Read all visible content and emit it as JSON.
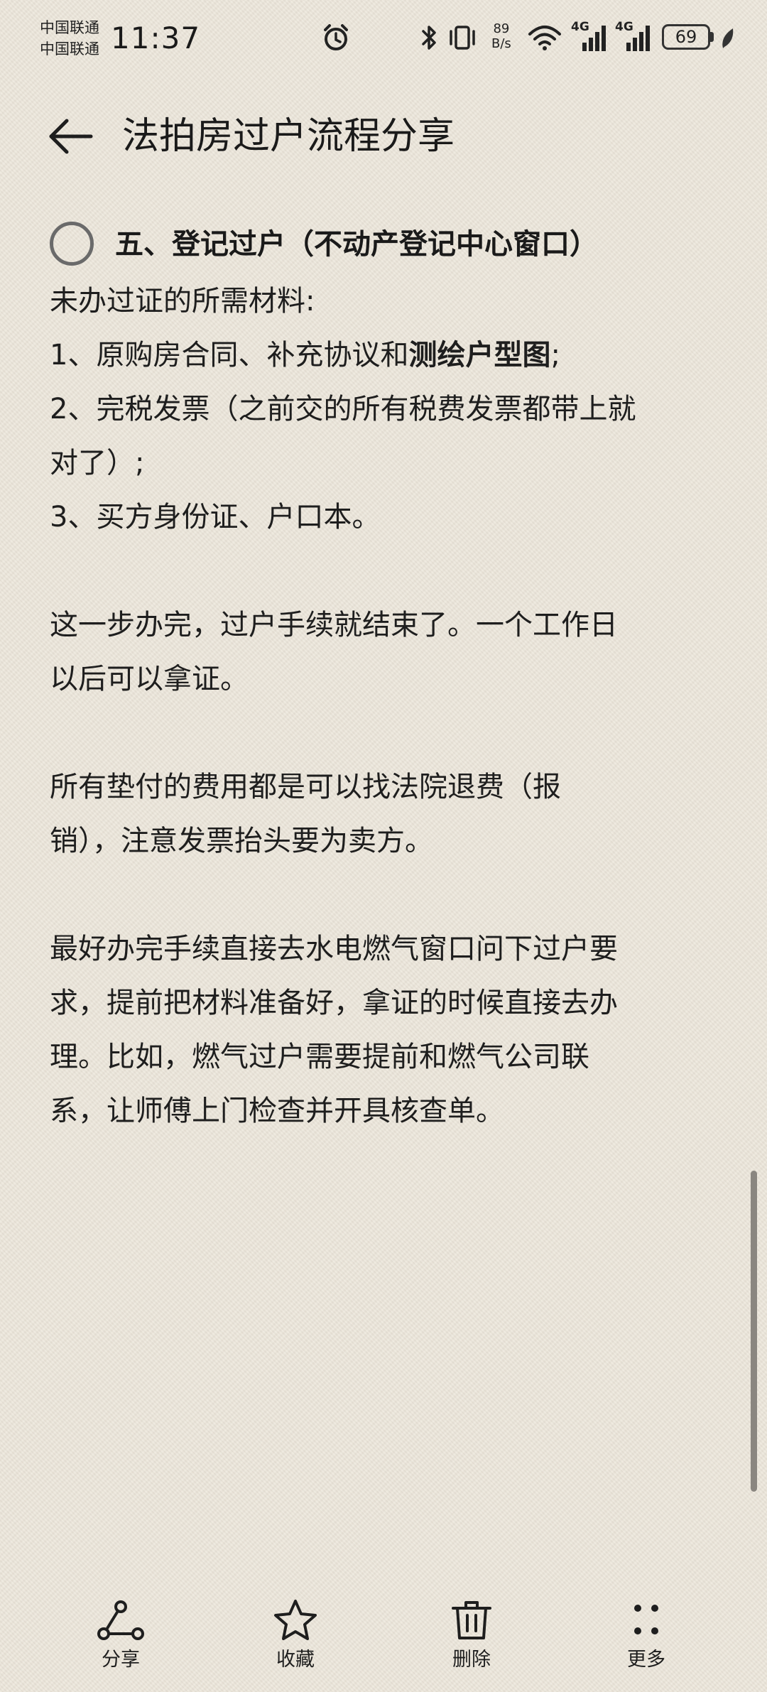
{
  "status_bar": {
    "carrier_1": "中国联通",
    "carrier_2": "中国联通",
    "time": "11:37",
    "net_speed_value": "89",
    "net_speed_unit": "B/s",
    "network_1": "4G",
    "network_2": "4G",
    "battery": "69",
    "icons": [
      "alarm-icon",
      "bluetooth-icon",
      "vibrate-icon",
      "wifi-icon",
      "signal-icon",
      "battery-icon",
      "leaf-icon"
    ]
  },
  "header": {
    "title": "法拍房过户流程分享",
    "back_icon": "arrow-left-icon"
  },
  "note": {
    "todo": {
      "checked": false,
      "text": "五、登记过户（不动产登记中心窗口）"
    },
    "paragraphs": [
      {
        "lines": [
          "未办过证的所需材料:"
        ]
      },
      {
        "lines": [
          "1、原购房合同、补充协议和",
          "测绘户型图",
          ";"
        ]
      },
      {
        "lines": [
          "2、完税发票（之前交的所有税费发票都带上就",
          "对了）;"
        ]
      },
      {
        "lines": [
          "3、买方身份证、户口本。"
        ]
      },
      {
        "lines": [
          "这一步办完，过户手续就结束了。一个工作日",
          "以后可以拿证。"
        ]
      },
      {
        "lines": [
          "所有垫付的费用都是可以找法院退费（报",
          "销），注意发票抬头要为卖方。"
        ]
      },
      {
        "lines": [
          "最好办完手续直接去水电燃气窗口问下过户要",
          "求，提前把材料准备好，拿证的时候直接去办",
          "理。比如，燃气过户需要提前和燃气公司联",
          "系，让师傅上门检查并开具核查单。"
        ]
      }
    ]
  },
  "toolbar": {
    "share_label": "分享",
    "favorite_label": "收藏",
    "delete_label": "删除",
    "more_label": "更多",
    "icons": [
      "share-icon",
      "star-icon",
      "trash-icon",
      "more-icon"
    ]
  },
  "colors": {
    "background": "#ece6da",
    "text": "#1e1e1e",
    "checkbox": "#6a6a6a"
  }
}
